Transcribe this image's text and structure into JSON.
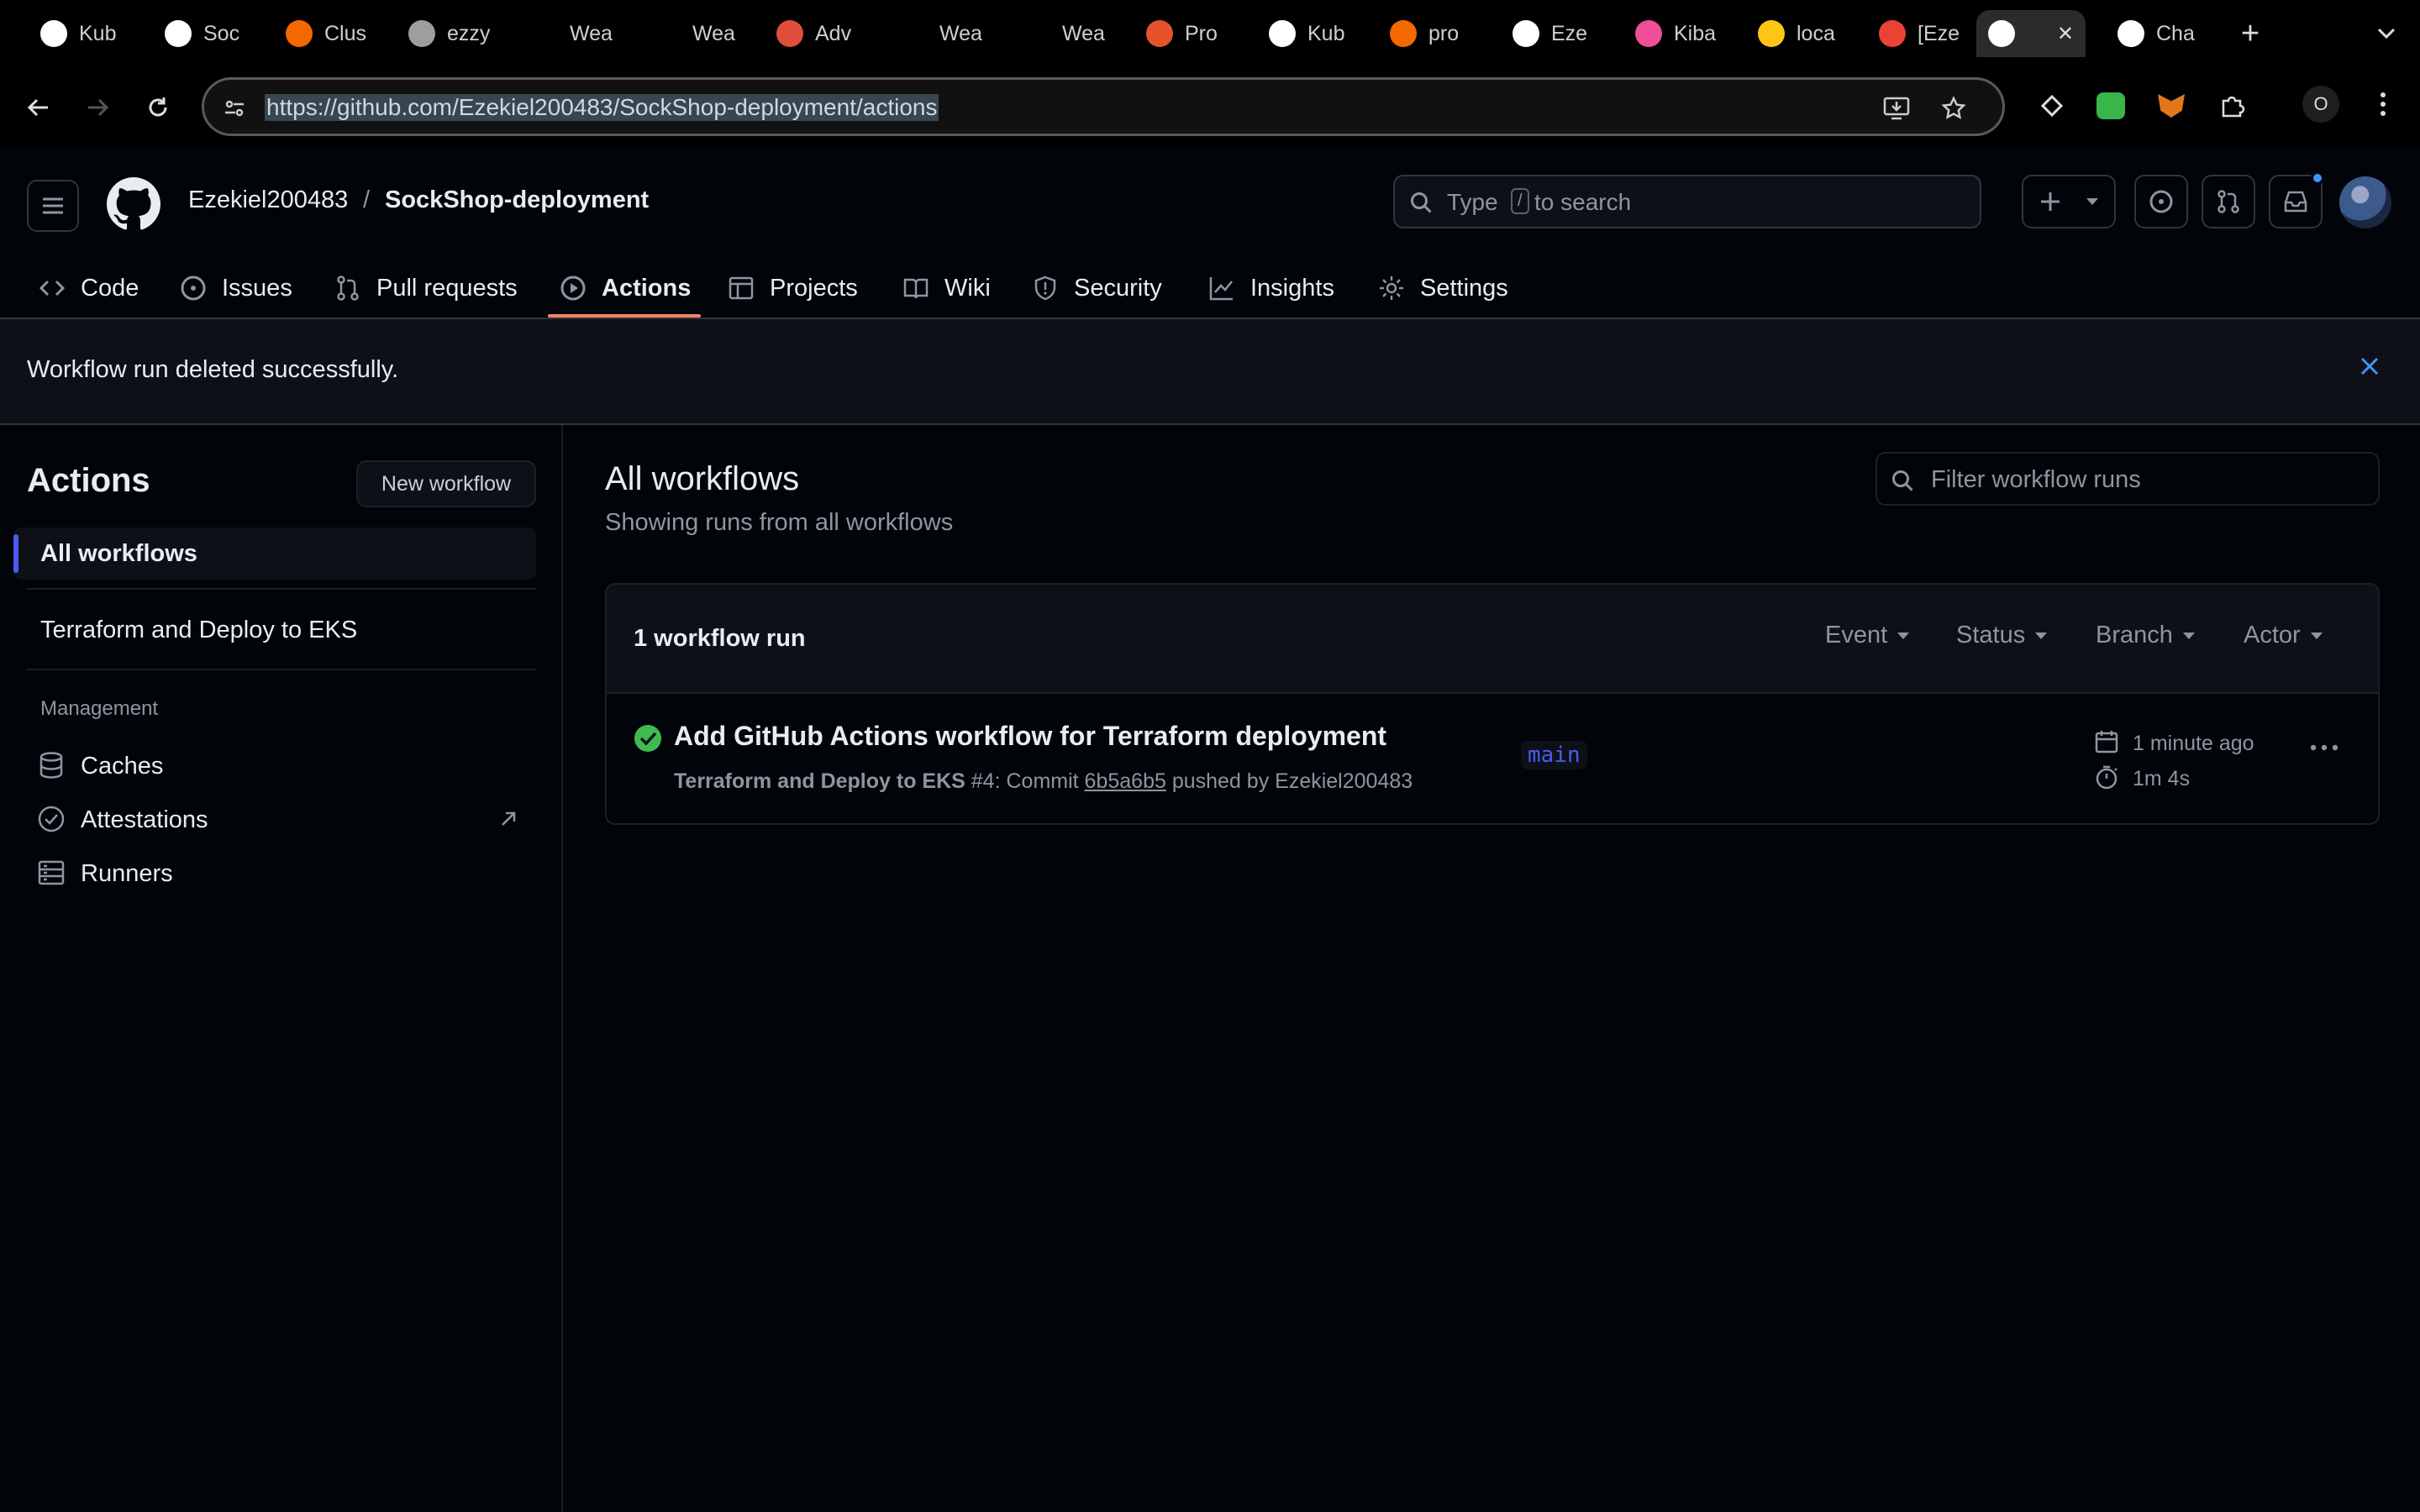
{
  "browser": {
    "tabs": [
      {
        "title": "Kub",
        "favicon": "openai-icon"
      },
      {
        "title": "Soc",
        "favicon": "github-icon"
      },
      {
        "title": "Clus",
        "favicon": "grafana-icon"
      },
      {
        "title": "ezzy",
        "favicon": "globe-icon"
      },
      {
        "title": "Wea",
        "favicon": ""
      },
      {
        "title": "Wea",
        "favicon": ""
      },
      {
        "title": "Adv",
        "favicon": "adv-icon"
      },
      {
        "title": "Wea",
        "favicon": ""
      },
      {
        "title": "Wea",
        "favicon": ""
      },
      {
        "title": "Pro",
        "favicon": "prometheus-icon"
      },
      {
        "title": "Kub",
        "favicon": "openai-icon"
      },
      {
        "title": "pro",
        "favicon": "grafana-icon"
      },
      {
        "title": "Eze",
        "favicon": "github-icon"
      },
      {
        "title": "Kiba",
        "favicon": "kibana-icon"
      },
      {
        "title": "loca",
        "favicon": "local-icon"
      },
      {
        "title": "[Eze",
        "favicon": "gmail-icon"
      },
      {
        "title": "",
        "favicon": "github-icon"
      },
      {
        "title": "Cha",
        "favicon": "openai-icon"
      }
    ],
    "url": "https://github.com/Ezekiel200483/SockShop-deployment/actions",
    "profile_badge": "O"
  },
  "repo": {
    "owner": "Ezekiel200483",
    "separator": "/",
    "name": "SockShop-deployment",
    "search_placeholder_pre": "Type",
    "search_key": "/",
    "search_placeholder_post": "to search"
  },
  "nav": {
    "code": "Code",
    "issues": "Issues",
    "pulls": "Pull requests",
    "actions": "Actions",
    "projects": "Projects",
    "wiki": "Wiki",
    "security": "Security",
    "insights": "Insights",
    "settings": "Settings"
  },
  "flash": {
    "message": "Workflow run deleted successfully."
  },
  "sidebar": {
    "title": "Actions",
    "new_workflow": "New workflow",
    "all_workflows": "All workflows",
    "workflow_1": "Terraform and Deploy to EKS",
    "management_heading": "Management",
    "caches": "Caches",
    "attestations": "Attestations",
    "runners": "Runners"
  },
  "main": {
    "title": "All workflows",
    "subtitle": "Showing runs from all workflows",
    "filter_placeholder": "Filter workflow runs",
    "run_count": "1 workflow run",
    "filters": {
      "event": "Event",
      "status": "Status",
      "branch": "Branch",
      "actor": "Actor"
    },
    "run": {
      "title": "Add GitHub Actions workflow for Terraform deployment",
      "workflow": "Terraform and Deploy to EKS",
      "number": "#4: Commit",
      "commit": "6b5a6b5",
      "pushed_by": "pushed by Ezekiel200483",
      "branch": "main",
      "time_ago": "1 minute ago",
      "duration": "1m 4s"
    }
  }
}
